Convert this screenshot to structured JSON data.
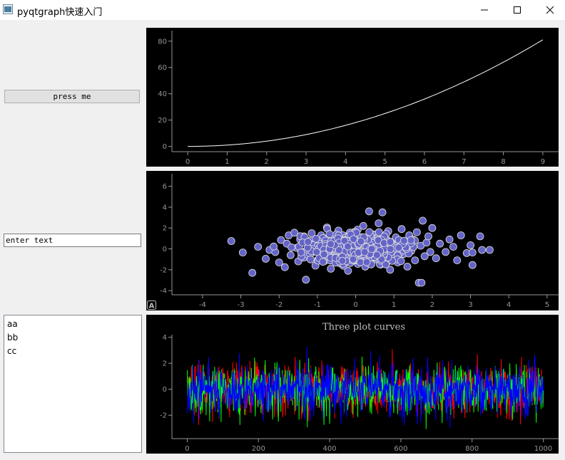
{
  "window": {
    "title": "pyqtgraph快速入门"
  },
  "button": {
    "label": "press me"
  },
  "text_input": {
    "value": "enter text"
  },
  "list": {
    "items": [
      "aa",
      "bb",
      "cc"
    ]
  },
  "plots": {
    "auto_range_label": "A"
  },
  "chart_data": [
    {
      "type": "line",
      "title": "",
      "x": [
        0,
        1,
        2,
        3,
        4,
        5,
        6,
        7,
        8,
        9
      ],
      "series": [
        {
          "values": [
            0,
            1,
            4,
            9,
            16,
            25,
            36,
            49,
            64,
            81
          ],
          "color": "#ffffff"
        }
      ],
      "xlim": [
        -0.4,
        9.4
      ],
      "ylim": [
        -4,
        88
      ],
      "xticks": [
        0,
        1,
        2,
        3,
        4,
        5,
        6,
        7,
        8,
        9
      ],
      "yticks": [
        0,
        20,
        40,
        60,
        80
      ],
      "grid": false
    },
    {
      "type": "scatter",
      "title": "",
      "points": [
        [
          -3.25,
          0.75
        ],
        [
          -2.95,
          -0.35
        ],
        [
          -2.7,
          -2.3
        ],
        [
          -2.55,
          0.2
        ],
        [
          -2.35,
          -0.95
        ],
        [
          -2.25,
          -0.1
        ],
        [
          -2.1,
          -0.3
        ],
        [
          -2.0,
          -1.3
        ],
        [
          -1.95,
          0.85
        ],
        [
          -1.85,
          -1.75
        ],
        [
          -1.8,
          0.5
        ],
        [
          -1.75,
          1.3
        ],
        [
          -1.7,
          -0.6
        ],
        [
          -1.6,
          1.55
        ],
        [
          -1.55,
          0.1
        ],
        [
          -1.5,
          -1.2
        ],
        [
          -1.45,
          0.9
        ],
        [
          -1.4,
          -0.3
        ],
        [
          -1.35,
          1.2
        ],
        [
          -1.3,
          -2.95
        ],
        [
          -1.25,
          0.5
        ],
        [
          -1.2,
          -0.9
        ],
        [
          -1.15,
          1.5
        ],
        [
          -1.1,
          0.0
        ],
        [
          -1.05,
          -1.6
        ],
        [
          -1.0,
          0.7
        ],
        [
          -0.95,
          -0.4
        ],
        [
          -0.9,
          1.3
        ],
        [
          -0.85,
          -1.1
        ],
        [
          -0.8,
          0.3
        ],
        [
          -0.75,
          2.05
        ],
        [
          -0.7,
          -0.2
        ],
        [
          -0.65,
          -1.9
        ],
        [
          -0.6,
          1.0
        ],
        [
          -0.55,
          -0.7
        ],
        [
          -0.5,
          0.5
        ],
        [
          -0.45,
          1.75
        ],
        [
          -0.4,
          -1.4
        ],
        [
          -0.35,
          0.2
        ],
        [
          -0.3,
          -0.5
        ],
        [
          -0.25,
          1.2
        ],
        [
          -0.2,
          -2.1
        ],
        [
          -0.15,
          0.6
        ],
        [
          -0.1,
          -0.9
        ],
        [
          -0.05,
          1.6
        ],
        [
          0.0,
          0.1
        ],
        [
          0.05,
          -1.2
        ],
        [
          0.1,
          0.9
        ],
        [
          0.15,
          -0.3
        ],
        [
          0.2,
          2.2
        ],
        [
          0.25,
          -1.7
        ],
        [
          0.3,
          0.4
        ],
        [
          0.35,
          3.6
        ],
        [
          0.4,
          -0.6
        ],
        [
          0.45,
          1.4
        ],
        [
          0.5,
          -1.0
        ],
        [
          0.55,
          0.2
        ],
        [
          0.6,
          2.45
        ],
        [
          0.65,
          -1.5
        ],
        [
          0.7,
          3.5
        ],
        [
          0.75,
          0.8
        ],
        [
          0.8,
          -0.4
        ],
        [
          0.85,
          1.7
        ],
        [
          0.9,
          -2.0
        ],
        [
          0.95,
          0.5
        ],
        [
          1.0,
          -0.8
        ],
        [
          1.05,
          1.1
        ],
        [
          1.1,
          -1.3
        ],
        [
          1.15,
          0.0
        ],
        [
          1.2,
          1.9
        ],
        [
          1.25,
          -0.5
        ],
        [
          1.3,
          0.7
        ],
        [
          1.35,
          -1.7
        ],
        [
          1.4,
          1.3
        ],
        [
          1.45,
          -0.2
        ],
        [
          1.5,
          0.9
        ],
        [
          1.55,
          -1.1
        ],
        [
          1.6,
          1.6
        ],
        [
          1.65,
          -3.25
        ],
        [
          1.7,
          0.3
        ],
        [
          1.72,
          -3.25
        ],
        [
          1.75,
          2.7
        ],
        [
          1.8,
          -0.7
        ],
        [
          1.85,
          0.6
        ],
        [
          1.9,
          1.2
        ],
        [
          1.95,
          -0.3
        ],
        [
          2.0,
          2.0
        ],
        [
          2.1,
          -0.9
        ],
        [
          2.2,
          0.5
        ],
        [
          2.35,
          -0.3
        ],
        [
          2.45,
          0.9
        ],
        [
          2.55,
          0.2
        ],
        [
          2.65,
          -1.1
        ],
        [
          2.75,
          1.3
        ],
        [
          2.9,
          -0.4
        ],
        [
          3.0,
          0.35
        ],
        [
          3.05,
          -0.35
        ],
        [
          3.05,
          -1.55
        ],
        [
          3.25,
          1.2
        ],
        [
          3.3,
          -0.1
        ],
        [
          3.5,
          -0.1
        ]
      ],
      "marker_color": "#6464c8",
      "marker_edge": "#dcdcdc",
      "xlim": [
        -4.8,
        5.3
      ],
      "ylim": [
        -4.4,
        7.2
      ],
      "xticks": [
        -4,
        -3,
        -2,
        -1,
        0,
        1,
        2,
        3,
        4,
        5
      ],
      "yticks": [
        -4,
        -2,
        0,
        2,
        4,
        6
      ],
      "grid": false
    },
    {
      "type": "line",
      "title": "Three plot curves",
      "x_range": [
        0,
        1000
      ],
      "series": [
        {
          "color": "#ff0000",
          "mean": 0,
          "std": 1
        },
        {
          "color": "#00ff00",
          "mean": 0,
          "std": 1
        },
        {
          "color": "#0000ff",
          "mean": 0,
          "std": 1
        }
      ],
      "xlim": [
        -43,
        1043
      ],
      "ylim": [
        -3.8,
        4.2
      ],
      "xticks": [
        0,
        200,
        400,
        600,
        800,
        1000
      ],
      "yticks": [
        -2,
        0,
        2,
        4
      ],
      "grid": false
    }
  ]
}
